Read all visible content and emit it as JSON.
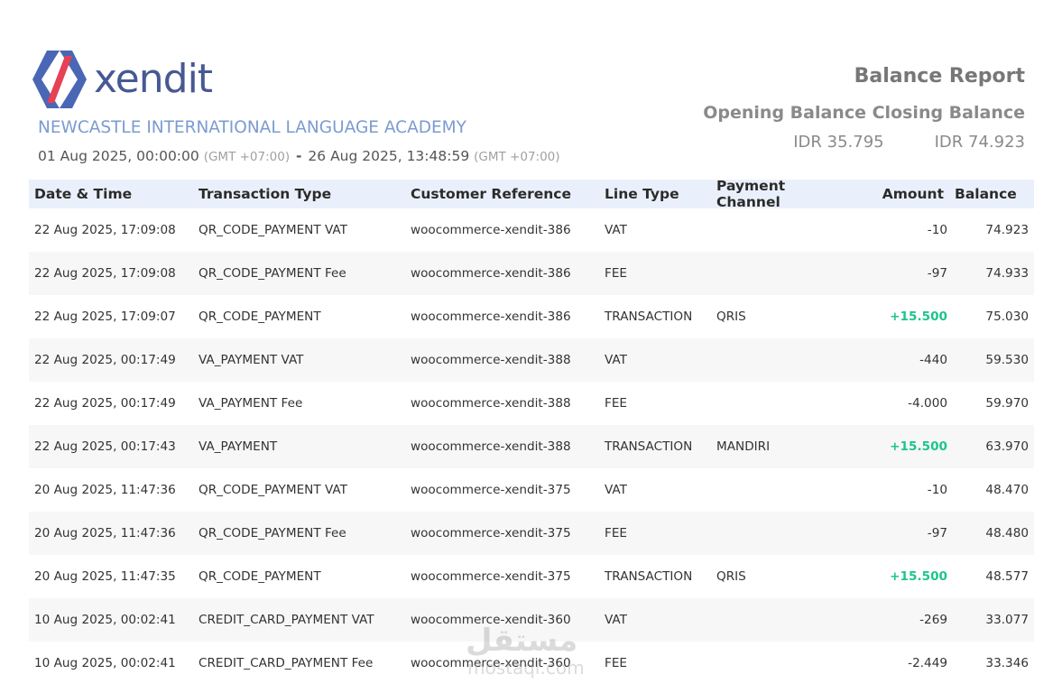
{
  "header": {
    "logo_text": "xendit",
    "merchant": "NEWCASTLE INTERNATIONAL LANGUAGE ACADEMY",
    "period_start": "01 Aug 2025, 00:00:00",
    "period_start_tz": "(GMT +07:00)",
    "period_sep": "-",
    "period_end": "26 Aug 2025, 13:48:59",
    "period_end_tz": "(GMT +07:00)",
    "report_title": "Balance Report",
    "opening_label": "Opening Balance",
    "closing_label": "Closing Balance",
    "opening_value": "IDR 35.795",
    "closing_value": "IDR 74.923"
  },
  "table": {
    "columns": [
      "Date & Time",
      "Transaction Type",
      "Customer Reference",
      "Line Type",
      "Payment Channel",
      "Amount",
      "Balance"
    ],
    "rows": [
      [
        "22 Aug 2025, 17:09:08",
        "QR_CODE_PAYMENT VAT",
        "woocommerce-xendit-386",
        "VAT",
        "",
        "-10",
        "74.923"
      ],
      [
        "22 Aug 2025, 17:09:08",
        "QR_CODE_PAYMENT Fee",
        "woocommerce-xendit-386",
        "FEE",
        "",
        "-97",
        "74.933"
      ],
      [
        "22 Aug 2025, 17:09:07",
        "QR_CODE_PAYMENT",
        "woocommerce-xendit-386",
        "TRANSACTION",
        "QRIS",
        "+15.500",
        "75.030"
      ],
      [
        "22 Aug 2025, 00:17:49",
        "VA_PAYMENT VAT",
        "woocommerce-xendit-388",
        "VAT",
        "",
        "-440",
        "59.530"
      ],
      [
        "22 Aug 2025, 00:17:49",
        "VA_PAYMENT Fee",
        "woocommerce-xendit-388",
        "FEE",
        "",
        "-4.000",
        "59.970"
      ],
      [
        "22 Aug 2025, 00:17:43",
        "VA_PAYMENT",
        "woocommerce-xendit-388",
        "TRANSACTION",
        "MANDIRI",
        "+15.500",
        "63.970"
      ],
      [
        "20 Aug 2025, 11:47:36",
        "QR_CODE_PAYMENT VAT",
        "woocommerce-xendit-375",
        "VAT",
        "",
        "-10",
        "48.470"
      ],
      [
        "20 Aug 2025, 11:47:36",
        "QR_CODE_PAYMENT Fee",
        "woocommerce-xendit-375",
        "FEE",
        "",
        "-97",
        "48.480"
      ],
      [
        "20 Aug 2025, 11:47:35",
        "QR_CODE_PAYMENT",
        "woocommerce-xendit-375",
        "TRANSACTION",
        "QRIS",
        "+15.500",
        "48.577"
      ],
      [
        "10 Aug 2025, 00:02:41",
        "CREDIT_CARD_PAYMENT VAT",
        "woocommerce-xendit-360",
        "VAT",
        "",
        "-269",
        "33.077"
      ],
      [
        "10 Aug 2025, 00:02:41",
        "CREDIT_CARD_PAYMENT Fee",
        "woocommerce-xendit-360",
        "FEE",
        "",
        "-2.449",
        "33.346"
      ]
    ]
  },
  "watermark": {
    "arabic": "مستقل",
    "latin": "mostaql.com"
  },
  "colors": {
    "brand": "#475993",
    "merchant": "#7b9bd1",
    "positive": "#1ec48f",
    "header_bg": "#eaf0fb"
  }
}
